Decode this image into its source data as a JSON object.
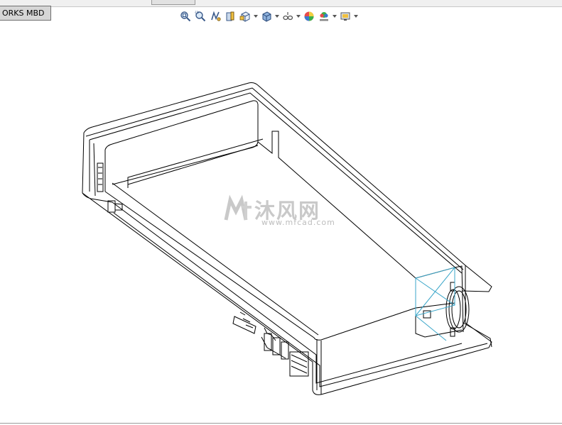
{
  "window": {
    "mbd_tab_label": "ORKS MBD"
  },
  "heads_up_toolbar": {
    "tools": [
      {
        "name": "zoom-to-fit",
        "icon": "zoom-fit-icon"
      },
      {
        "name": "zoom-to-area",
        "icon": "zoom-area-icon"
      },
      {
        "name": "previous-view",
        "icon": "previous-view-icon"
      },
      {
        "name": "section-view",
        "icon": "section-view-icon"
      },
      {
        "name": "view-orientation",
        "icon": "view-orientation-icon",
        "dropdown": true
      },
      {
        "name": "display-style",
        "icon": "display-style-icon",
        "dropdown": true
      },
      {
        "name": "hide-show-items",
        "icon": "hide-show-icon",
        "dropdown": true
      },
      {
        "name": "edit-appearance",
        "icon": "appearance-icon"
      },
      {
        "name": "apply-scene",
        "icon": "scene-icon",
        "dropdown": true
      },
      {
        "name": "view-settings",
        "icon": "view-settings-icon",
        "dropdown": true
      }
    ]
  },
  "watermark": {
    "brand_text": "沐风网",
    "url_text": "www.mfcad.com",
    "logo": "mf-logo"
  },
  "colors": {
    "background": "#ffffff",
    "wire": "#000000",
    "highlight": "#3aa6c9",
    "watermark": "#c9c9c9"
  }
}
